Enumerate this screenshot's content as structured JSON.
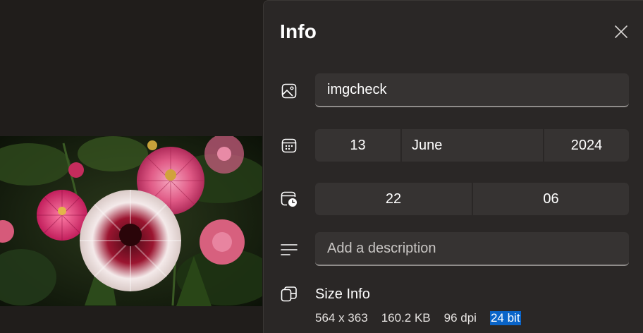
{
  "panel": {
    "title": "Info",
    "close_icon": "close-icon"
  },
  "file": {
    "icon": "image-icon",
    "name": "imgcheck"
  },
  "date": {
    "icon": "calendar-icon",
    "day": "13",
    "month": "June",
    "year": "2024"
  },
  "time": {
    "icon": "clock-calendar-icon",
    "hour": "22",
    "minute": "06"
  },
  "description": {
    "icon": "text-lines-icon",
    "placeholder": "Add a description",
    "value": ""
  },
  "size_info": {
    "icon": "size-info-icon",
    "title": "Size Info",
    "dimensions": "564 x 363",
    "file_size": "160.2 KB",
    "dpi": "96 dpi",
    "bit_depth": "24 bit"
  },
  "colors": {
    "panel_bg": "#2a2726",
    "field_bg": "#363332",
    "selection": "#0a64c8"
  }
}
